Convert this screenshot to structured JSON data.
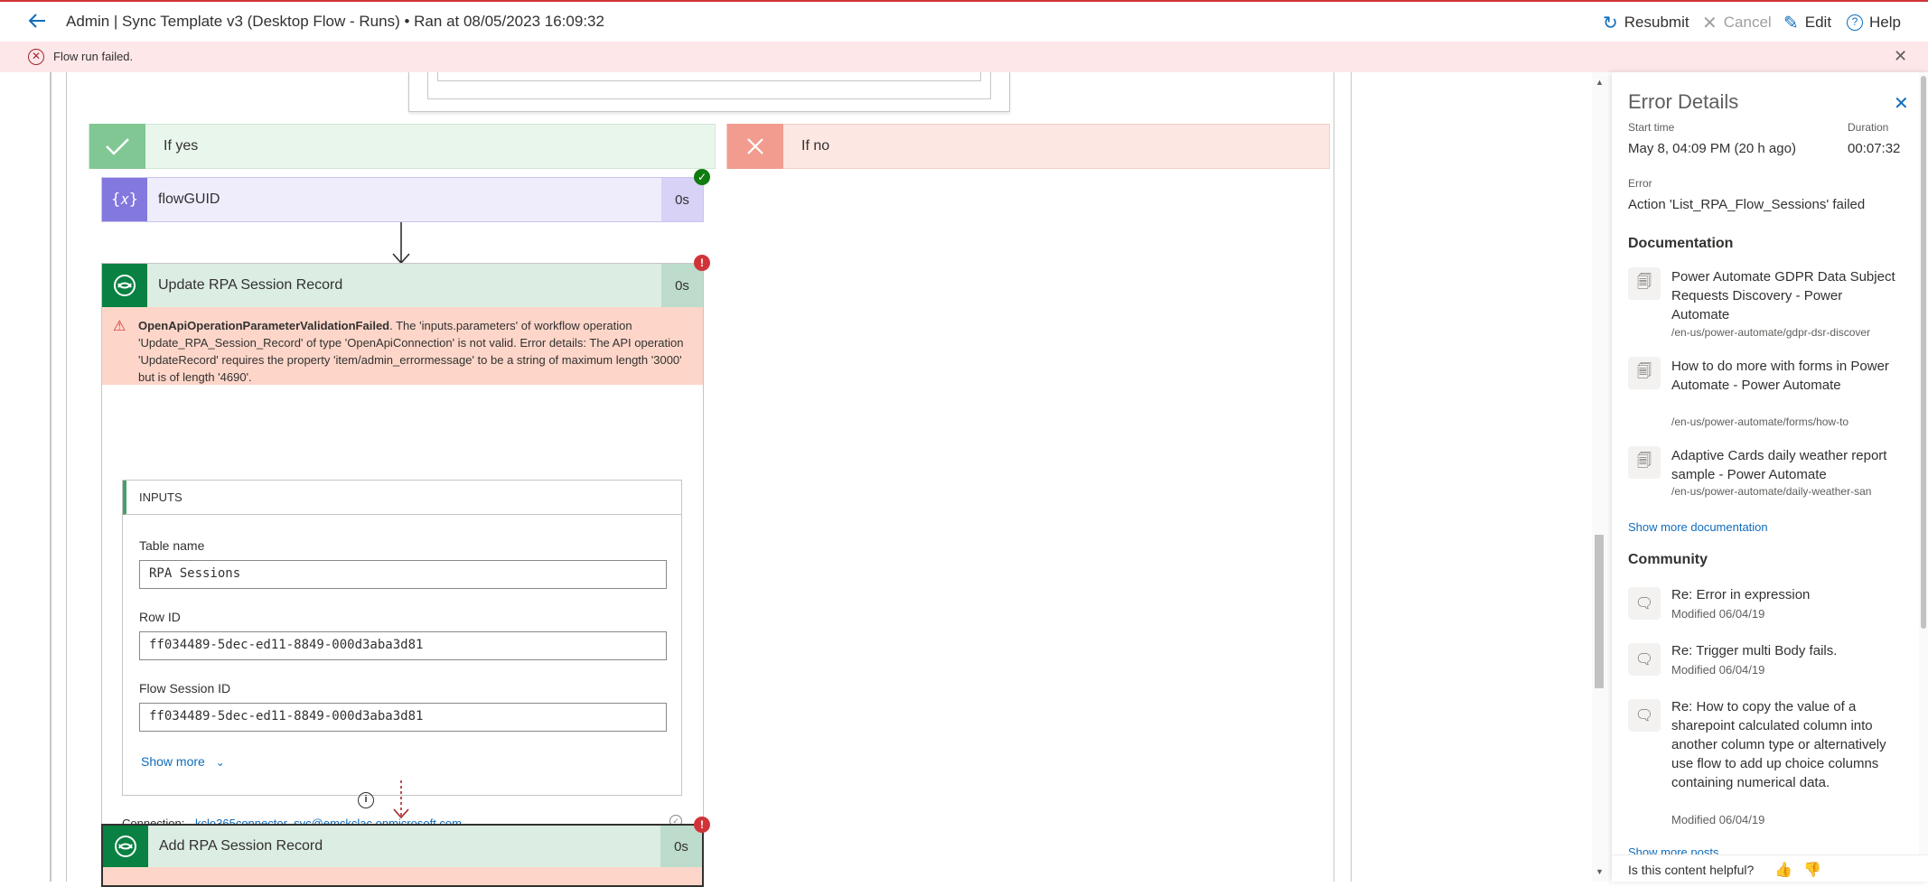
{
  "header": {
    "title": "Admin | Sync Template v3 (Desktop Flow - Runs)",
    "separator": "•",
    "run_time": "Ran at 08/05/2023 16:09:32",
    "resubmit": "Resubmit",
    "cancel": "Cancel",
    "edit": "Edit",
    "help": "Help"
  },
  "banner": {
    "text": "Flow run failed."
  },
  "branches": {
    "yes": "If yes",
    "no": "If no"
  },
  "flow_guid": {
    "name": "flowGUID",
    "duration": "0s"
  },
  "update_record": {
    "name": "Update RPA Session Record",
    "duration": "0s",
    "error_code": "OpenApiOperationParameterValidationFailed",
    "error_message": ". The 'inputs.parameters' of workflow operation 'Update_RPA_Session_Record' of type 'OpenApiConnection' is not valid. Error details: The API operation 'UpdateRecord' requires the property 'item/admin_errormessage' to be a string of maximum length '3000' but is of length '4690'.",
    "inputs_header": "INPUTS",
    "fields": [
      {
        "label": "Table name",
        "value": "RPA Sessions"
      },
      {
        "label": "Row ID",
        "value": "ff034489-5dec-ed11-8849-000d3aba3d81"
      },
      {
        "label": "Flow Session ID",
        "value": "ff034489-5dec-ed11-8849-000d3aba3d81"
      }
    ],
    "show_more": "Show more",
    "connection_label": "Connection:",
    "connection_value": "kclo365connector_svc@emckclac.onmicrosoft.com"
  },
  "add_record": {
    "name": "Add RPA Session Record",
    "duration": "0s"
  },
  "panel": {
    "title": "Error Details",
    "start_label": "Start time",
    "start_value": "May 8, 04:09 PM (20 h ago)",
    "duration_label": "Duration",
    "duration_value": "00:07:32",
    "error_label": "Error",
    "error_value": "Action 'List_RPA_Flow_Sessions' failed",
    "documentation_heading": "Documentation",
    "docs": [
      {
        "title": "Power Automate GDPR Data Subject Requests Discovery - Power Automate",
        "url": "/en-us/power-automate/gdpr-dsr-discover"
      },
      {
        "title": "How to do more with forms in Power Automate - Power Automate",
        "url": "/en-us/power-automate/forms/how-to"
      },
      {
        "title": "Adaptive Cards daily weather report sample - Power Automate",
        "url": "/en-us/power-automate/daily-weather-san"
      }
    ],
    "show_more_docs": "Show more documentation",
    "community_heading": "Community",
    "posts": [
      {
        "title": "Re: Error in expression",
        "modified": "Modified 06/04/19"
      },
      {
        "title": "Re: Trigger multi Body fails.",
        "modified": "Modified 06/04/19"
      },
      {
        "title": "Re: How to copy the value of a sharepoint calculated column into another column type or alternatively use flow to add up choice columns containing numerical data.",
        "modified": "Modified 06/04/19"
      }
    ],
    "show_more_posts": "Show more posts",
    "feedback": "Is this content helpful?"
  },
  "colors": {
    "accent": "#0f6cbd",
    "error_banner": "#fde7e9",
    "yes_branch": "#e9f6ec",
    "no_branch": "#fde7e3",
    "variable_purple": "#8378de",
    "dataverse_green": "#088142",
    "error_red": "#d13438"
  }
}
